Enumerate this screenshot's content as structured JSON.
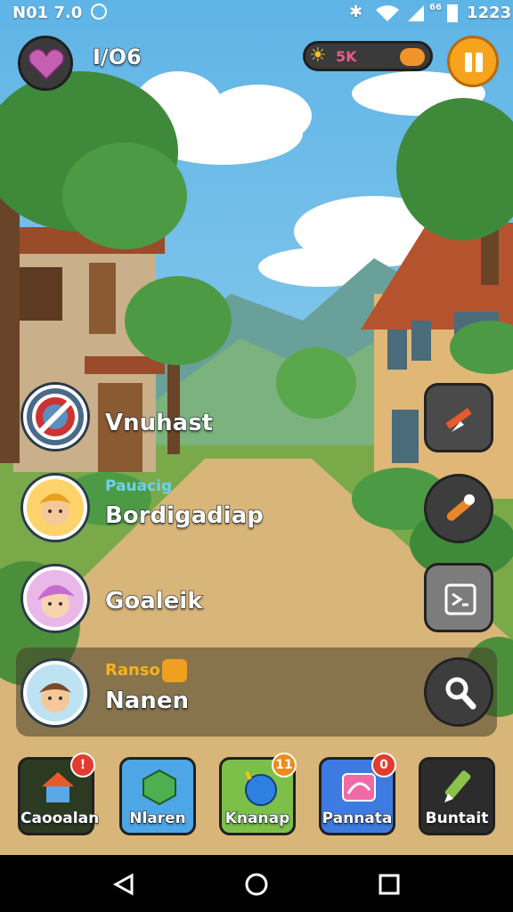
{
  "statusbar": {
    "left_text": "N01 7.0",
    "right_text": "1223",
    "signal_label": "66"
  },
  "hud": {
    "profile_value": "I/O6",
    "meter_text": "5K"
  },
  "colors": {
    "sky_top": "#5fb4e6",
    "sky_bottom": "#a9dcf2",
    "path": "#d8b579",
    "grass": "#7aa94a",
    "accent_orange": "#f6a31d",
    "badge_red": "#e33b2f"
  },
  "list": {
    "items": [
      {
        "subtitle": "",
        "title": "Vnuhast"
      },
      {
        "subtitle": "Pauacig",
        "title": "Bordigadiap"
      },
      {
        "subtitle": "",
        "title": "Goaleik"
      },
      {
        "subtitle": "Ranso",
        "title": "Nanen"
      }
    ]
  },
  "bottom_bar": {
    "items": [
      {
        "label": "Caooalan",
        "badge": "!"
      },
      {
        "label": "Nlaren",
        "badge": ""
      },
      {
        "label": "Knanap",
        "badge": "11"
      },
      {
        "label": "Pannata",
        "badge": "0"
      },
      {
        "label": "Buntait",
        "badge": ""
      }
    ]
  }
}
